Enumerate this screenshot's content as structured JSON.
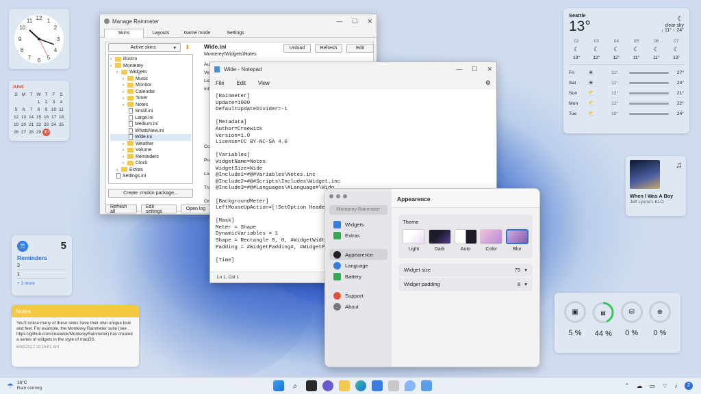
{
  "clock": {
    "label": "analog clock"
  },
  "calendar": {
    "month": "JUNE",
    "days": [
      "S",
      "M",
      "T",
      "W",
      "T",
      "F",
      "S"
    ],
    "weeks": [
      [
        "",
        "",
        "",
        "1",
        "2",
        "3",
        "4"
      ],
      [
        "5",
        "6",
        "7",
        "8",
        "9",
        "10",
        "11"
      ],
      [
        "12",
        "13",
        "14",
        "15",
        "16",
        "17",
        "18"
      ],
      [
        "19",
        "20",
        "21",
        "22",
        "23",
        "24",
        "25"
      ],
      [
        "26",
        "27",
        "28",
        "29",
        "30",
        "",
        ""
      ]
    ],
    "today": "30"
  },
  "reminders": {
    "count": "5",
    "title": "Reminders",
    "items": [
      "3",
      "1"
    ],
    "more": "+ 3 more"
  },
  "notes": {
    "header": "Notes",
    "body": "You'll notice many of these skins have their own unique look and feel. For example, the Monterey Rainmeter suite (see https://github.com/creewick/MontereyRainmeter) has created a series of widgets in the style of macOS.",
    "timestamp": "6/30/2022 10:15:01 AM"
  },
  "weather": {
    "city": "Seattle",
    "temp": "13°",
    "condition": "clear sky",
    "lowhigh": "↓ 11° ↑ 24°",
    "hours": [
      {
        "h": "02",
        "t": "13°"
      },
      {
        "h": "03",
        "t": "12°"
      },
      {
        "h": "04",
        "t": "12°"
      },
      {
        "h": "05",
        "t": "11°"
      },
      {
        "h": "06",
        "t": "11°"
      },
      {
        "h": "07",
        "t": "13°"
      }
    ],
    "days": [
      {
        "d": "Fri",
        "lo": "11°",
        "hi": "27°"
      },
      {
        "d": "Sat",
        "lo": "11°",
        "hi": "24°"
      },
      {
        "d": "Sun",
        "lo": "12°",
        "hi": "21°"
      },
      {
        "d": "Mon",
        "lo": "12°",
        "hi": "22°"
      },
      {
        "d": "Tue",
        "lo": "10°",
        "hi": "24°"
      }
    ]
  },
  "music": {
    "title": "When I Was A Boy",
    "artist": "Jeff Lynne's ELO"
  },
  "system": {
    "values": [
      "5 %",
      "44 %",
      "0 %",
      "0 %"
    ],
    "gpu_fill": 0.44
  },
  "manage": {
    "title": "Manage Rainmeter",
    "tabs": [
      "Skins",
      "Layouts",
      "Game mode",
      "Settings"
    ],
    "dropdown": "Active skins",
    "tree": [
      "illustro",
      "Monterey",
      "Widgets",
      "Music",
      "Monitor",
      "Calendar",
      "Timer",
      "Notes",
      "Small.ini",
      "Large.ini",
      "Medium.ini",
      "WhatsNew.ini",
      "Wide.ini",
      "Weather",
      "Volume",
      "Reminders",
      "Clock",
      "Extras",
      "Settings.ini"
    ],
    "create": "Create .rmskin package...",
    "refresh_all": "Refresh all",
    "edit_settings": "Edit settings",
    "open_log": "Open log",
    "skin_name": "Wide.ini",
    "skin_path": "Monterey\\Widgets\\Notes",
    "unload": "Unload",
    "refresh": "Refresh",
    "edit": "Edit",
    "side_labels": [
      "Autho",
      "Versi",
      "Lice",
      "Info"
    ],
    "author_val": "Creewick",
    "side2": [
      "Coo",
      "Pos",
      "Loa",
      "Tran",
      "On"
    ]
  },
  "notepad": {
    "title": "Wide - Notepad",
    "menu": [
      "File",
      "Edit",
      "View"
    ],
    "status": "Ln 1, Col 1",
    "lines": [
      "[Rainmeter]",
      "Update=1000",
      "DefaultUpdateDivider=-1",
      "",
      "[Metadata]",
      "Author=Creewick",
      "Version=1.0",
      "License=CC BY-NC-SA 4.0",
      "",
      "[Variables]",
      "WidgetName=Notes",
      "WidgetSize=Wide",
      "@Include1=#@#Variables\\Notes.inc",
      "@Include2=#@#Scripts\\Includes\\Widget.inc",
      "@Include3=#@#Languages\\#Language#\\Widg",
      "",
      "[BackgroundMeter]",
      "LeftMouseUpAction=[!SetOption Header T",
      "",
      "[Mask]",
      "Meter = Shape",
      "DynamicVariables = 1",
      "Shape = Rectangle 0, 0, #WidgetWidth#,",
      "Padding = #WidgetPadding#, #WidgetPadd",
      "",
      "[Time]"
    ]
  },
  "settings": {
    "search": "Monterey Rainmeter",
    "title": "Appearence",
    "nav1": [
      "Widgets",
      "Extras"
    ],
    "nav2": [
      "Appearence",
      "Language",
      "Battery"
    ],
    "nav3": [
      "Support",
      "About"
    ],
    "theme_label": "Theme",
    "themes": [
      "Light",
      "Dark",
      "Auto",
      "Color",
      "Blur"
    ],
    "size_label": "Widget size",
    "size_val": "75",
    "pad_label": "Widget padding",
    "pad_val": "8"
  },
  "taskbar": {
    "temp": "16°C",
    "cond": "Rain coming"
  }
}
